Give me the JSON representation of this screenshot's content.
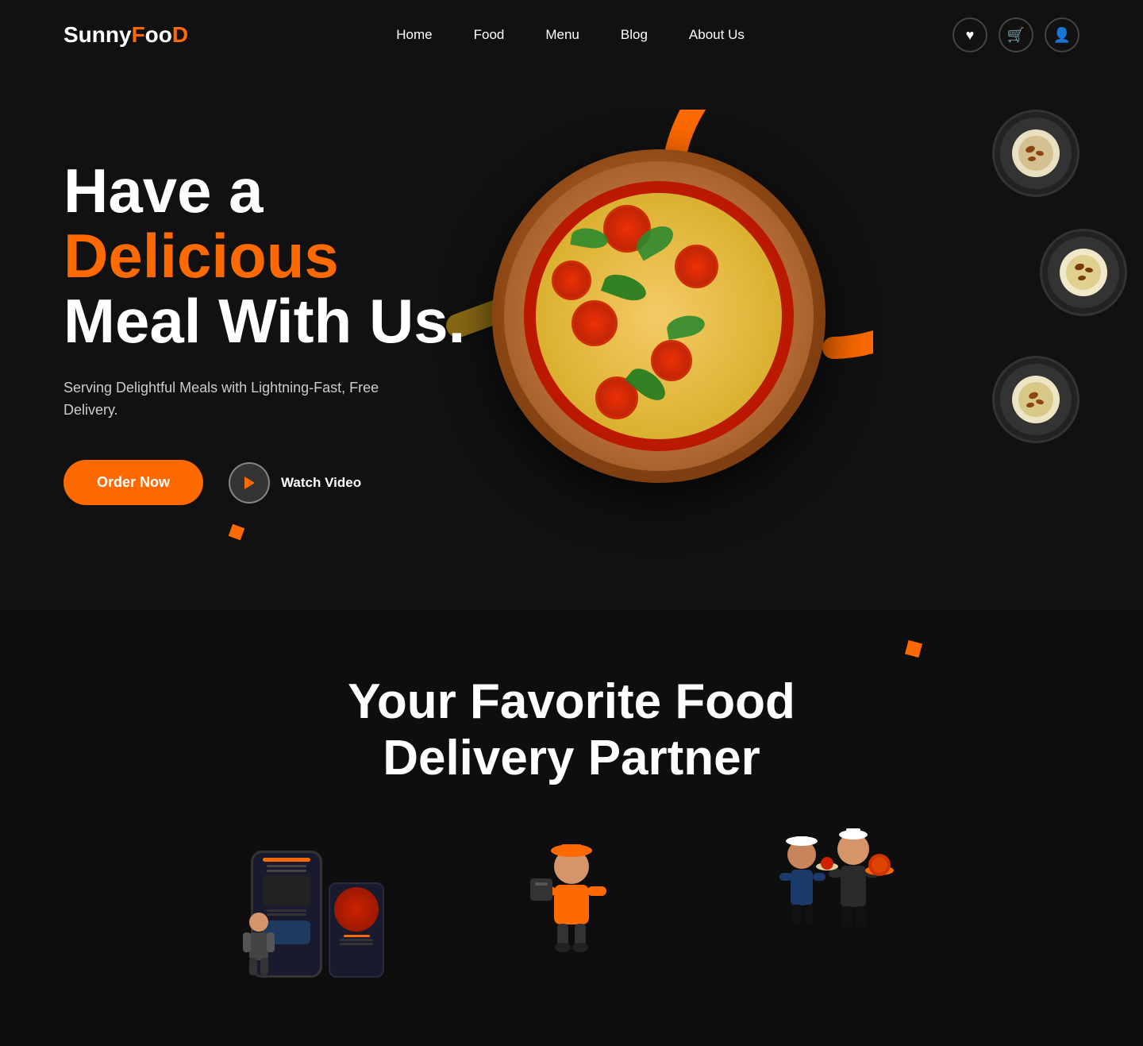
{
  "brand": {
    "name_prefix": "Sunny",
    "name_accent": "F",
    "name_oo": "oo",
    "name_suffix": "D"
  },
  "nav": {
    "links": [
      {
        "id": "home",
        "label": "Home"
      },
      {
        "id": "food",
        "label": "Food"
      },
      {
        "id": "menu",
        "label": "Menu"
      },
      {
        "id": "blog",
        "label": "Blog"
      },
      {
        "id": "about",
        "label": "About Us"
      }
    ],
    "icons": [
      {
        "id": "heart",
        "symbol": "♥"
      },
      {
        "id": "cart",
        "symbol": "🛒"
      },
      {
        "id": "user",
        "symbol": "👤"
      }
    ]
  },
  "hero": {
    "title_line1_plain": "Have a",
    "title_line1_accent": "Delicious",
    "title_line2": "Meal With Us.",
    "subtitle": "Serving Delightful Meals with Lightning-Fast, Free Delivery.",
    "cta_primary": "Order Now",
    "cta_secondary": "Watch Video"
  },
  "section2": {
    "title_line1": "Your Favorite Food",
    "title_line2": "Delivery Partner"
  },
  "colors": {
    "accent": "#ff6a00",
    "bg": "#111111",
    "text": "#ffffff",
    "muted": "#cccccc"
  }
}
